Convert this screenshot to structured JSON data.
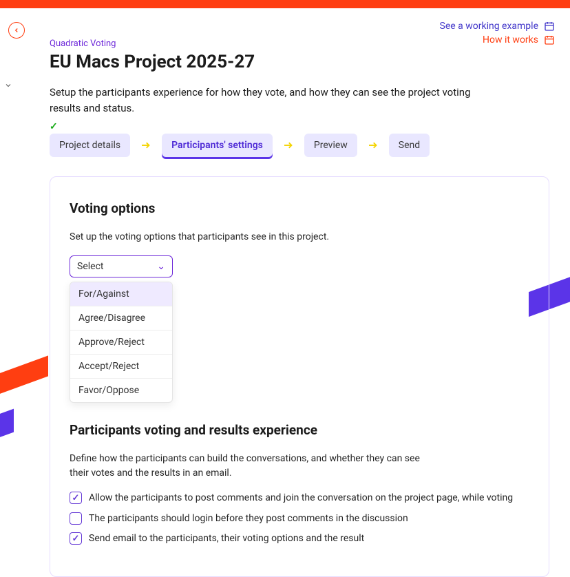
{
  "header": {
    "example_link": "See a working example",
    "how_link": "How it works"
  },
  "page": {
    "eyebrow": "Quadratic Voting",
    "title": "EU Macs Project 2025-27",
    "subtitle": "Setup the participants experience for how they vote, and how they can see the project voting results and status."
  },
  "wizard": {
    "step1": "Project details",
    "step2": "Participants' settings",
    "step3": "Preview",
    "step4": "Send"
  },
  "voting": {
    "heading": "Voting options",
    "desc": "Set up the voting options that participants see in this project.",
    "select_label": "Select",
    "options": {
      "o0": "For/Against",
      "o1": "Agree/Disagree",
      "o2": "Approve/Reject",
      "o3": "Accept/Reject",
      "o4": "Favor/Oppose"
    }
  },
  "experience": {
    "heading": "Participants voting and results experience",
    "desc": "Define how the participants can build the conversations, and whether they can see their votes and the results in an email.",
    "c0": "Allow the participants to post comments and join the conversation on the project page, while voting",
    "c1": "The participants should login before they post comments in the discussion",
    "c2": "Send email to the participants, their voting options and the result"
  }
}
